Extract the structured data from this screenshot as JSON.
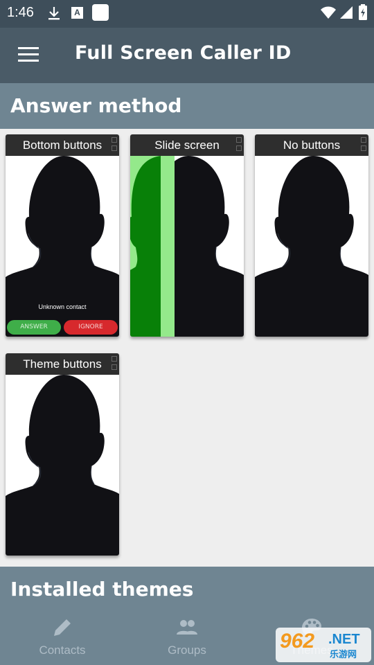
{
  "status_bar": {
    "time": "1:46",
    "a_icon_label": "A",
    "icons": [
      "download-icon",
      "a-notification-icon",
      "app-notification-icon",
      "wifi-icon",
      "signal-icon",
      "battery-charging-icon"
    ]
  },
  "app_bar": {
    "title": "Full Screen Caller ID",
    "menu_icon": "menu-icon"
  },
  "sections": {
    "answer_method": "Answer method",
    "installed_themes": "Installed themes"
  },
  "cards": [
    {
      "caption": "Bottom buttons",
      "contact_text": "Unknown contact",
      "answer_label": "ANSWER",
      "ignore_label": "IGNORE"
    },
    {
      "caption": "Slide screen"
    },
    {
      "caption": "No buttons"
    },
    {
      "caption": "Theme buttons"
    }
  ],
  "bottom_nav": [
    {
      "label": "Contacts",
      "icon": "pencil-icon"
    },
    {
      "label": "Groups",
      "icon": "people-icon"
    },
    {
      "label": "Themes",
      "icon": "palette-icon"
    }
  ],
  "watermark": {
    "number": "962",
    "domain": ".NET",
    "chinese": "乐游网"
  },
  "colors": {
    "status_bar": "#3e4e5a",
    "app_bar": "#4a5b67",
    "section_header": "#6f8592",
    "background": "#eeeeee",
    "answer_green": "#3fae49",
    "ignore_red": "#d7292d",
    "slide_green": "#0d6b0d"
  }
}
